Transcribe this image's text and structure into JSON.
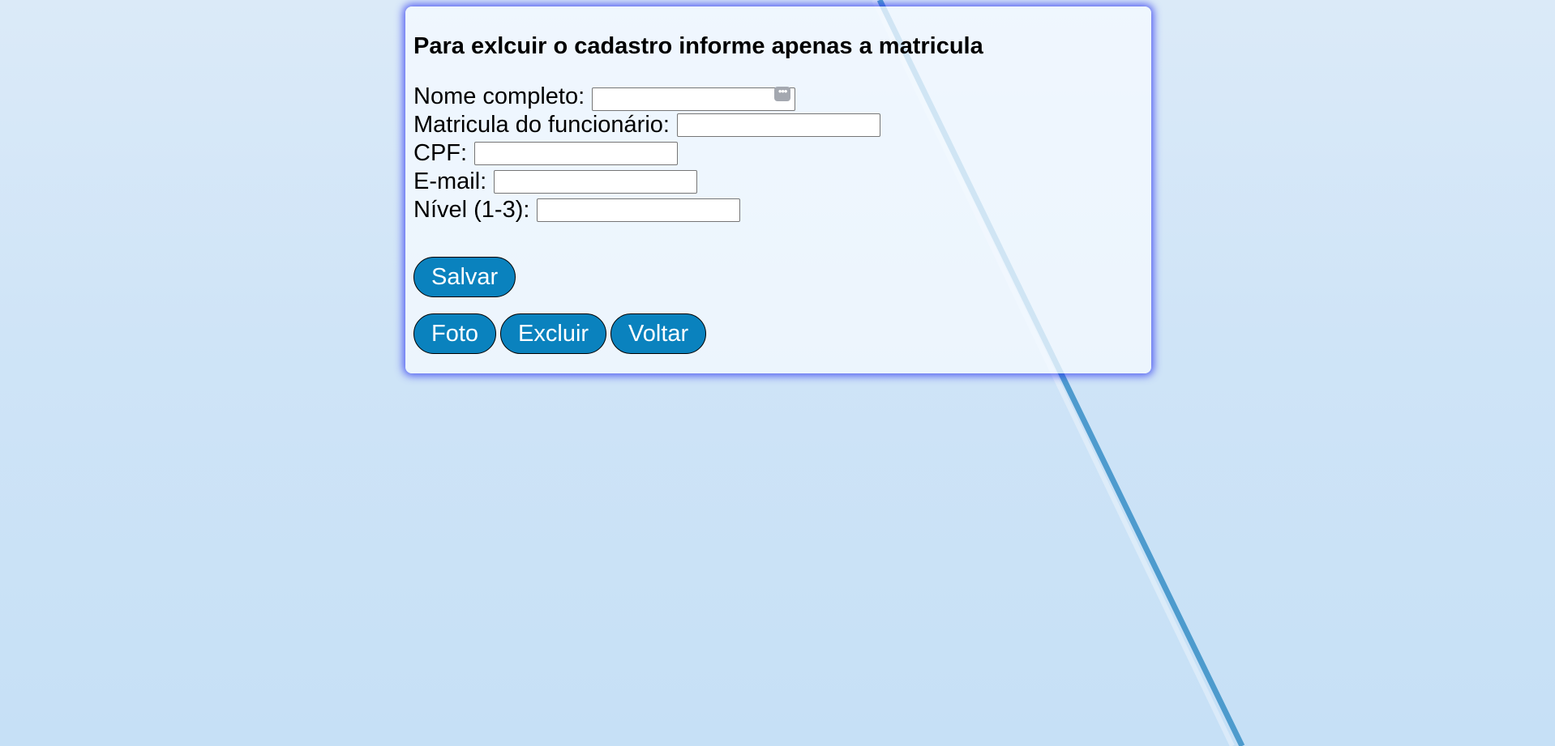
{
  "form": {
    "title": "Para exlcuir o cadastro informe apenas a matricula",
    "fields": [
      {
        "label": "Nome completo:",
        "value": ""
      },
      {
        "label": "Matricula do funcionário:",
        "value": ""
      },
      {
        "label": "CPF:",
        "value": ""
      },
      {
        "label": "E-mail:",
        "value": ""
      },
      {
        "label": "Nível (1-3):",
        "value": ""
      }
    ],
    "autofill_icon": "more-horizontal-icon"
  },
  "buttons": {
    "save": "Salvar",
    "photo": "Foto",
    "delete": "Excluir",
    "back": "Voltar"
  },
  "colors": {
    "button_bg": "#0a82be",
    "card_glow": "#2832f0",
    "page_bg": "#cfe4f7"
  }
}
